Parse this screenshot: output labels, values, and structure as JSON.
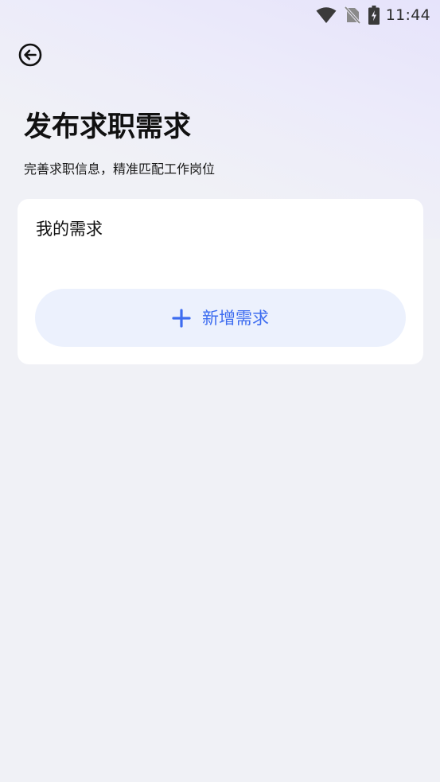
{
  "status_bar": {
    "time": "11:44",
    "icons": [
      "wifi-icon",
      "no-sim-icon",
      "battery-charging-icon"
    ]
  },
  "header": {
    "back_icon": "back-arrow-circle-icon",
    "title": "发布求职需求",
    "subtitle": "完善求职信息，精准匹配工作岗位"
  },
  "demand_card": {
    "title": "我的需求",
    "add_button_label": "新增需求",
    "add_icon": "plus-icon"
  },
  "colors": {
    "accent": "#3d6cf0",
    "button_bg": "#ecf1fd",
    "page_bg": "#f0f1f6",
    "card_bg": "#ffffff"
  }
}
